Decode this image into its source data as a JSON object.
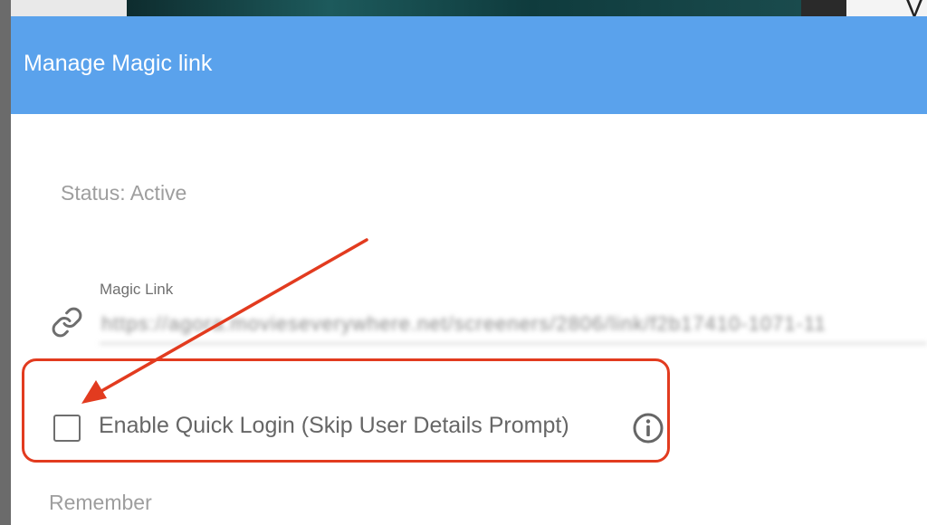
{
  "background": {
    "partial_letter": "V"
  },
  "dialog": {
    "title": "Manage Magic link",
    "status_text": "Status: Active",
    "magic_link": {
      "label": "Magic Link",
      "value": "https://agora.movieseverywhere.net/screeners/2806/link/f2b17410-1071-11"
    },
    "quick_login": {
      "label": "Enable Quick Login (Skip User Details Prompt)",
      "checked": false
    },
    "remember_text": "Remember"
  },
  "icons": {
    "link": "link-icon",
    "info": "info-icon"
  },
  "colors": {
    "header": "#5aa2ec",
    "annotation": "#e23b1f",
    "muted_text": "#9e9e9e"
  }
}
